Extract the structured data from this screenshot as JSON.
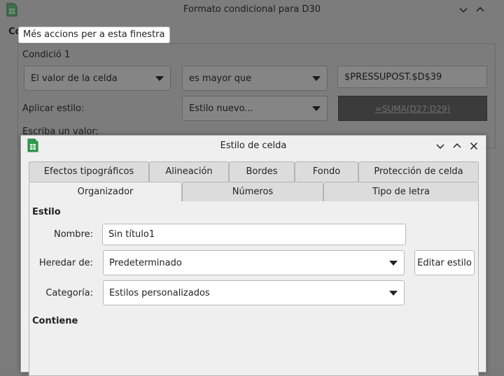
{
  "background_dialog": {
    "title": "Formato condicional para D30",
    "condition_section_label_cut": "Co",
    "tooltip": "Més accions per a esta finestra",
    "condition_label": "Condició 1",
    "condition_type": "El valor de la celda",
    "operator": "es mayor que",
    "value_input": "$PRESSUPOST.$D$39",
    "apply_style_label": "Aplicar estilo:",
    "apply_style_value": "Estilo nuevo...",
    "preview_text": "=SUMA(D27:D29)",
    "enter_value_label": "Escriba un valor:"
  },
  "cell_style_dialog": {
    "title": "Estilo de celda",
    "tabs_row1": [
      "Efectos tipográficos",
      "Alineación",
      "Bordes",
      "Fondo",
      "Protección de celda"
    ],
    "tabs_row2": [
      "Organizador",
      "Números",
      "Tipo de letra"
    ],
    "active_tab": "Organizador",
    "style_section": "Estilo",
    "name_label": "Nombre:",
    "name_value": "Sin título1",
    "inherit_label": "Heredar de:",
    "inherit_value": "Predeterminado",
    "edit_style_button": "Editar estilo",
    "category_label": "Categoría:",
    "category_value": "Estilos personalizados",
    "contains_section": "Contiene"
  },
  "icons": {
    "app_icon": "calc-spreadsheet-icon",
    "minimize": "chevron-down-icon",
    "maximize": "chevron-up-icon",
    "close": "close-icon"
  },
  "colors": {
    "dimmed_background": "#7c7c7c",
    "dialog_background": "#efefef",
    "app_icon_green": "#2e9d4e"
  }
}
